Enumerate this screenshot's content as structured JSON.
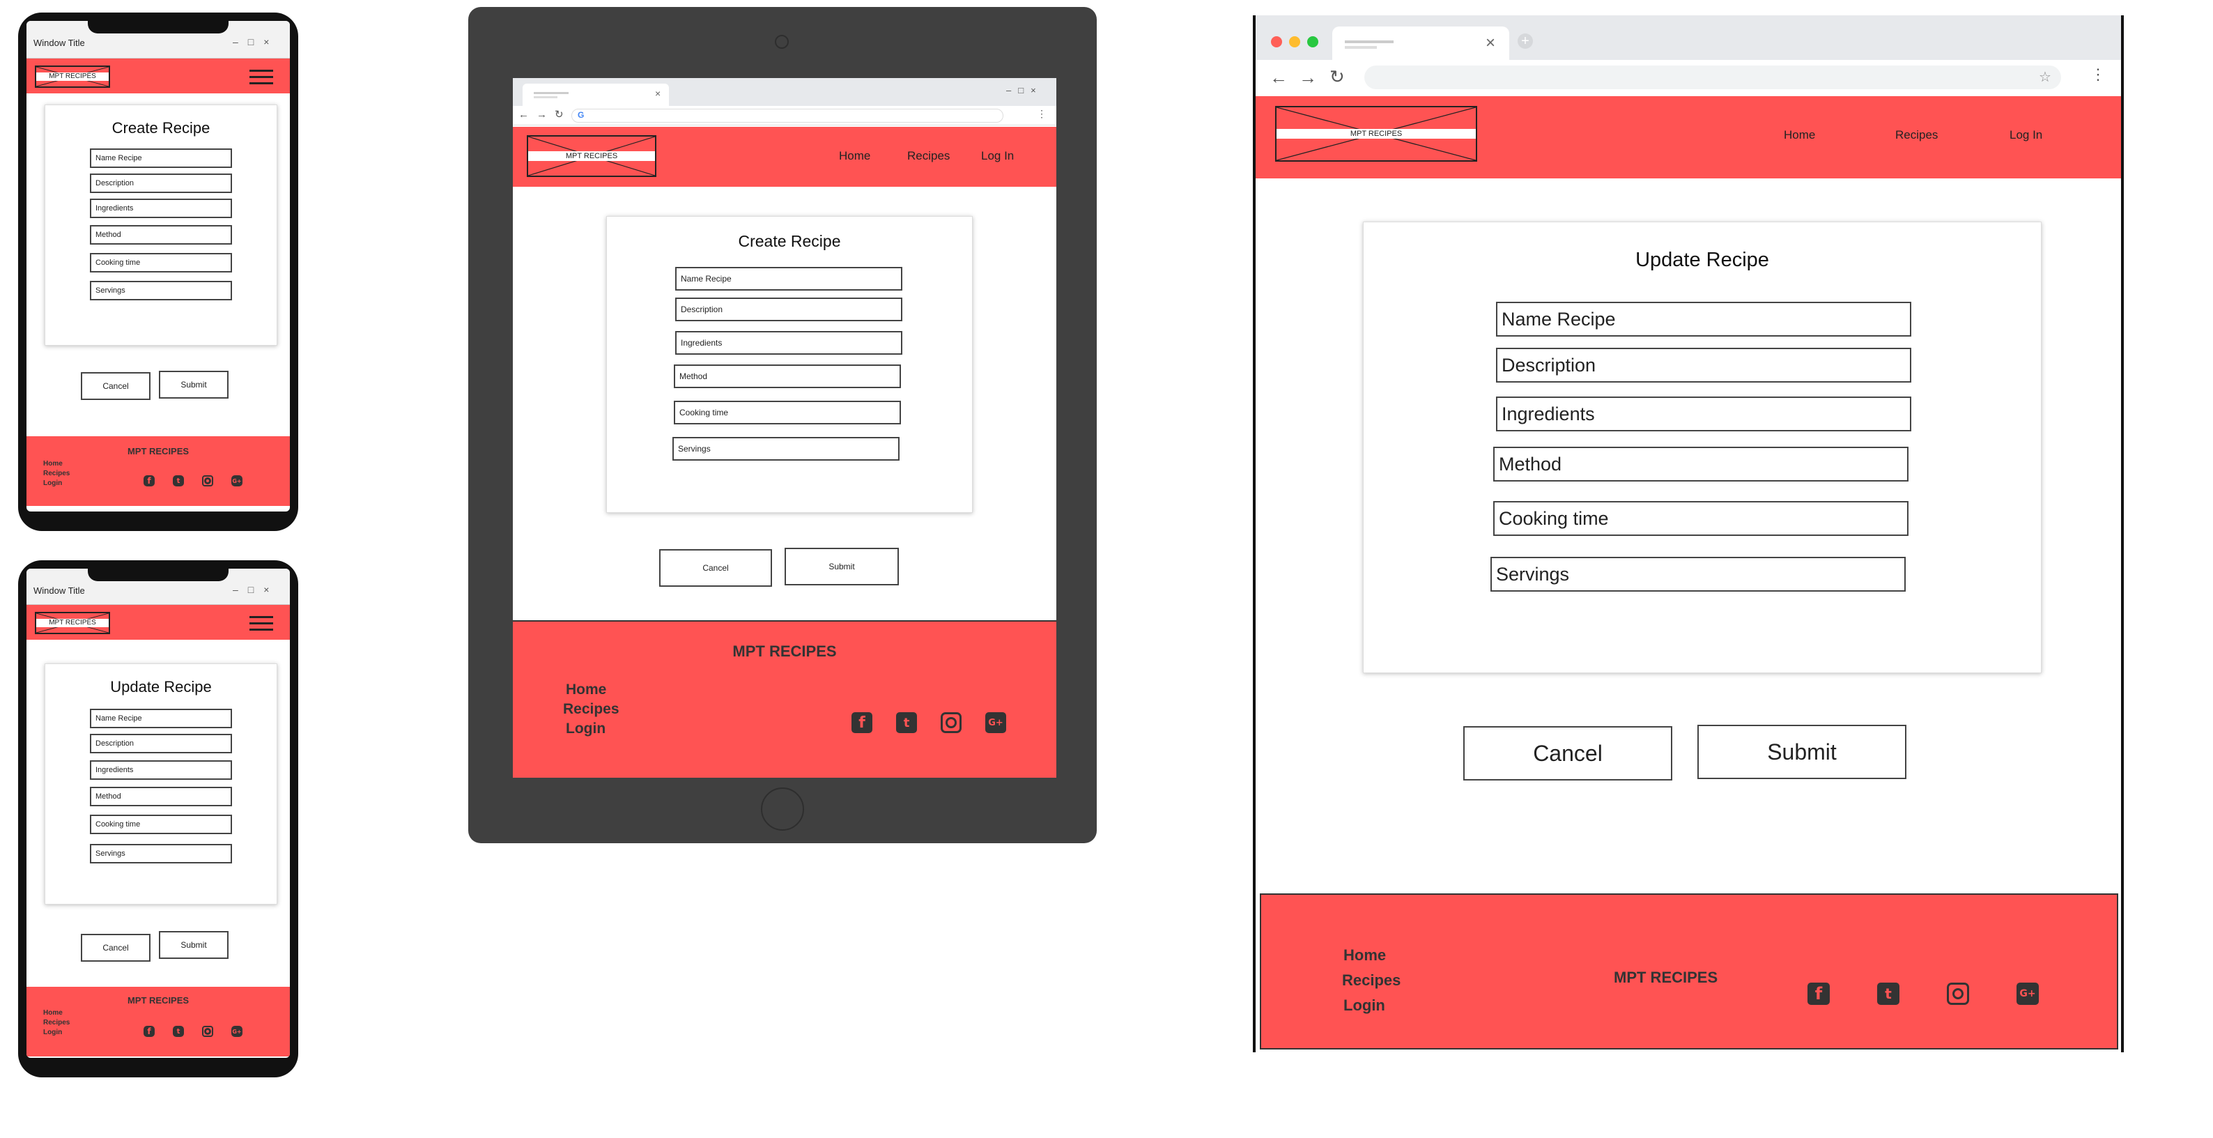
{
  "brand": {
    "logo_text": "MPT RECIPES",
    "footer_name": "MPT  RECIPES",
    "accent_color": "#ff5353"
  },
  "nav": {
    "home": "Home",
    "recipes": "Recipes",
    "login": "Log In"
  },
  "footer": {
    "links": [
      "Home",
      "Recipes",
      "Login"
    ],
    "social_icons": [
      "facebook-icon",
      "twitter-icon",
      "instagram-icon",
      "google-plus-icon"
    ]
  },
  "phone_window": {
    "title": "Window Title",
    "controls": "–□×"
  },
  "create_form": {
    "title": "Create Recipe",
    "fields": [
      "Name Recipe",
      "Description",
      "Ingredients",
      "Method",
      "Cooking time",
      "Servings"
    ],
    "cancel": "Cancel",
    "submit": "Submit"
  },
  "update_form": {
    "title": "Update Recipe",
    "fields": [
      "Name Recipe",
      "Description",
      "Ingredients",
      "Method",
      "Cooking time",
      "Servings"
    ],
    "cancel": "Cancel",
    "submit": "Submit"
  }
}
